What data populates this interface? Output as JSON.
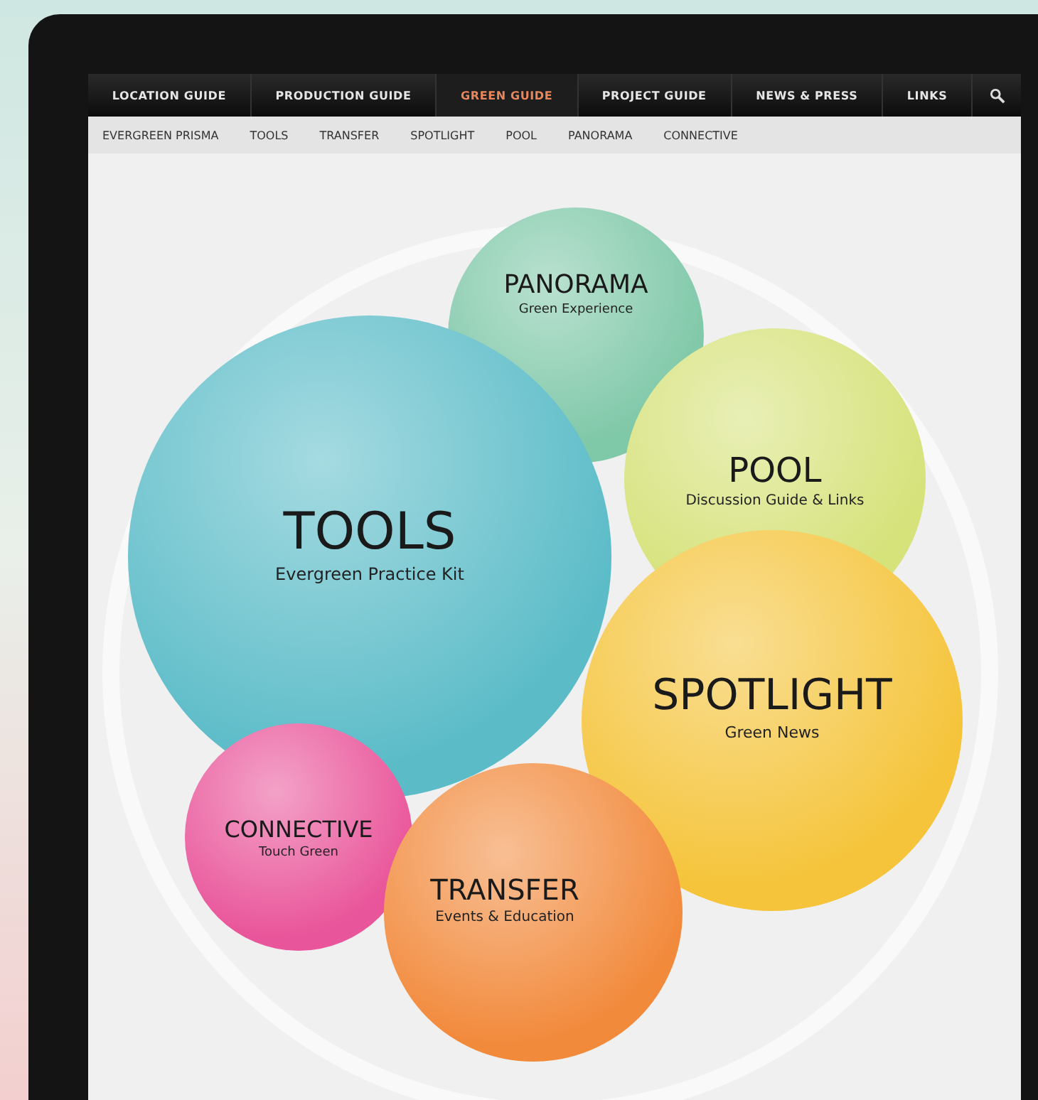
{
  "main_nav": [
    {
      "label": "LOCATION GUIDE",
      "selected": false
    },
    {
      "label": "PRODUCTION GUIDE",
      "selected": false
    },
    {
      "label": "GREEN GUIDE",
      "selected": true
    },
    {
      "label": "PROJECT GUIDE",
      "selected": false
    },
    {
      "label": "NEWS & PRESS",
      "selected": false
    },
    {
      "label": "LINKS",
      "selected": false
    }
  ],
  "sub_nav": [
    "EVERGREEN PRISMA",
    "TOOLS",
    "TRANSFER",
    "SPOTLIGHT",
    "POOL",
    "PANORAMA",
    "CONNECTIVE"
  ],
  "bubbles": [
    {
      "title": "PANORAMA",
      "subtitle": "Green Experience",
      "color": "#7fc8a8"
    },
    {
      "title": "POOL",
      "subtitle": "Discussion Guide & Links",
      "color": "#d6e27a"
    },
    {
      "title": "TOOLS",
      "subtitle": "Evergreen Practice Kit",
      "color": "#5bbcc8"
    },
    {
      "title": "SPOTLIGHT",
      "subtitle": "Green News",
      "color": "#f5c43a"
    },
    {
      "title": "CONNECTIVE",
      "subtitle": "Touch Green",
      "color": "#e9559a"
    },
    {
      "title": "TRANSFER",
      "subtitle": "Events & Education",
      "color": "#f28a3c"
    }
  ]
}
